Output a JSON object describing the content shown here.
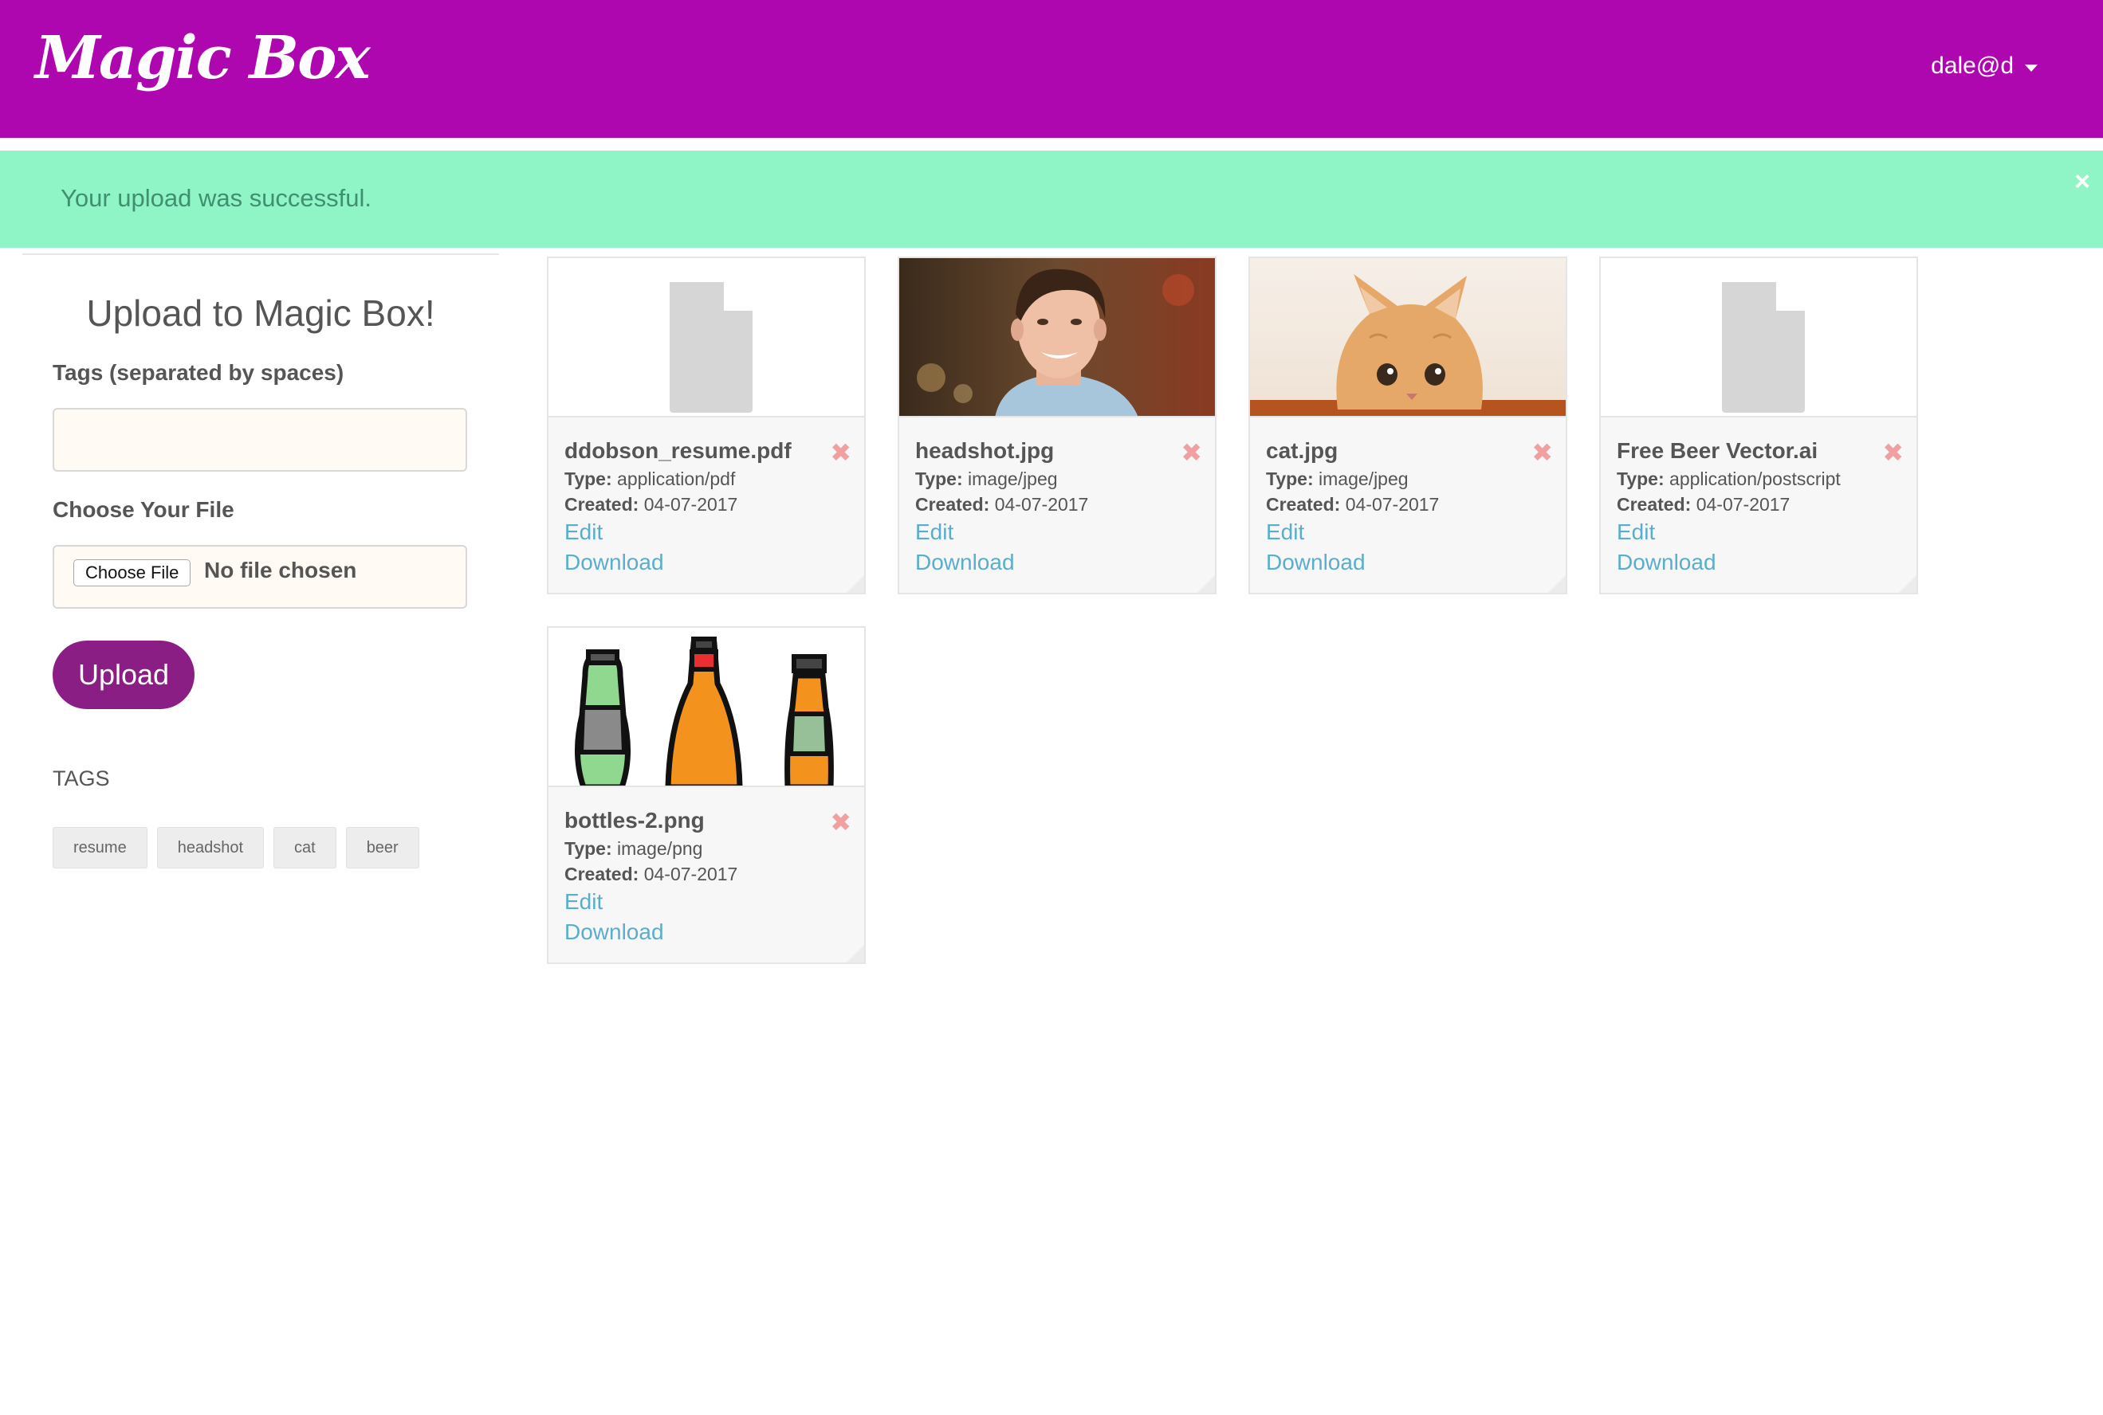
{
  "header": {
    "brand": "Magic Box",
    "user": "dale@d"
  },
  "alert": {
    "message": "Your upload was successful.",
    "close": "×"
  },
  "sidebar": {
    "title": "Upload to Magic Box!",
    "tags_label": "Tags (separated by spaces)",
    "tags_value": "",
    "file_label": "Choose Your File",
    "choose_button": "Choose File",
    "no_file": "No file chosen",
    "upload_button": "Upload",
    "tags_heading": "TAGS",
    "tags": [
      "resume",
      "headshot",
      "cat",
      "beer"
    ]
  },
  "card_labels": {
    "type": "Type:",
    "created": "Created:",
    "edit": "Edit",
    "download": "Download",
    "delete": "✖"
  },
  "files": [
    {
      "name": "ddobson_resume.pdf",
      "type": "application/pdf",
      "created": "04-07-2017",
      "thumb": "document-icon"
    },
    {
      "name": "headshot.jpg",
      "type": "image/jpeg",
      "created": "04-07-2017",
      "thumb": "headshot-photo"
    },
    {
      "name": "cat.jpg",
      "type": "image/jpeg",
      "created": "04-07-2017",
      "thumb": "kitten-photo"
    },
    {
      "name": "Free Beer Vector.ai",
      "type": "application/postscript",
      "created": "04-07-2017",
      "thumb": "document-icon"
    },
    {
      "name": "bottles-2.png",
      "type": "image/png",
      "created": "04-07-2017",
      "thumb": "bottles-illustration"
    }
  ],
  "colors": {
    "header": "#af07af",
    "alert": "#8ff5c6",
    "upload_button": "#8a1e85",
    "link": "#5aaecb",
    "delete": "#f0a0a0"
  }
}
